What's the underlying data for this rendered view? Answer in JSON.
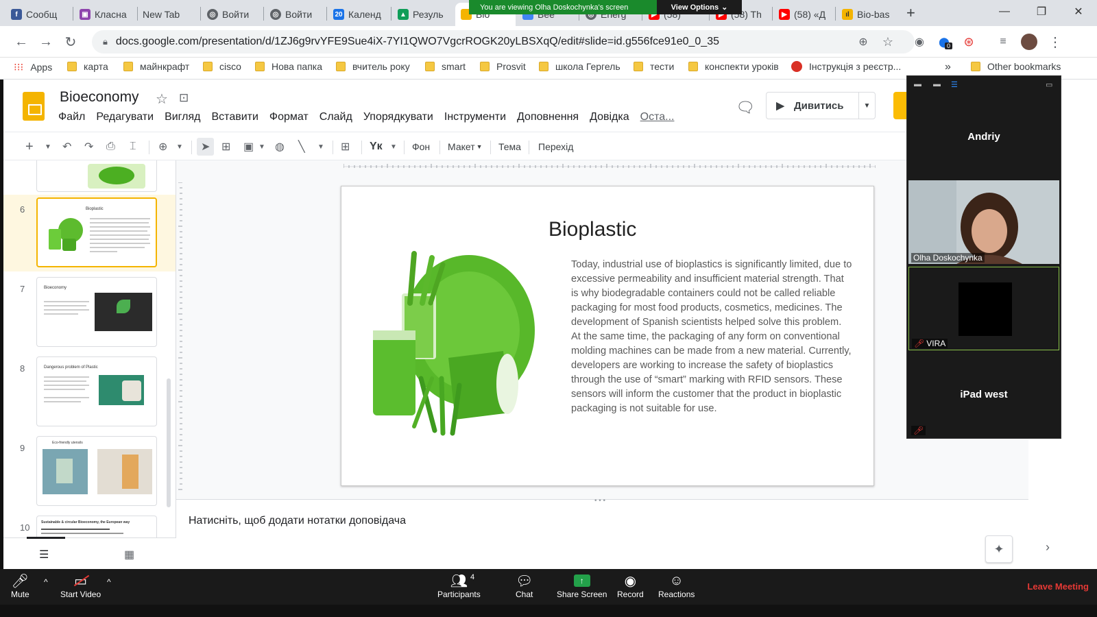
{
  "browser": {
    "tabs": [
      {
        "label": "Сообщ",
        "icon": "facebook-icon"
      },
      {
        "label": "Класна",
        "icon": "classroom-icon"
      },
      {
        "label": "New Tab",
        "icon": ""
      },
      {
        "label": "Войти",
        "icon": "globe-icon"
      },
      {
        "label": "Войти",
        "icon": "globe-icon"
      },
      {
        "label": "Календ",
        "icon": "calendar-icon"
      },
      {
        "label": "Резуль",
        "icon": "drive-icon"
      },
      {
        "label": "Bio",
        "icon": "slides-icon"
      },
      {
        "label": "Bee",
        "icon": "docs-icon"
      },
      {
        "label": "Energ",
        "icon": "globe-icon"
      },
      {
        "label": "(58)",
        "icon": "youtube-icon"
      },
      {
        "label": "(58) Th",
        "icon": "youtube-icon"
      },
      {
        "label": "(58) «Д",
        "icon": "youtube-icon"
      },
      {
        "label": "Bio-bas",
        "icon": "chart-icon"
      }
    ],
    "new_tab": "+",
    "url": "docs.google.com/presentation/d/1ZJ6g9rvYFE9Sue4iX-7YI1QWO7VgcrROGK20yLBSXqQ/edit#slide=id.g556fce91e0_0_35",
    "extension_badge": "0",
    "bookmarks": [
      {
        "label": "Apps",
        "icon": "apps-grid-icon"
      },
      {
        "label": "карта",
        "icon": "folder-icon"
      },
      {
        "label": "майнкрафт",
        "icon": "folder-icon"
      },
      {
        "label": "cisco",
        "icon": "folder-icon"
      },
      {
        "label": "Нова папка",
        "icon": "folder-icon"
      },
      {
        "label": "вчитель року",
        "icon": "folder-icon"
      },
      {
        "label": "smart",
        "icon": "folder-icon"
      },
      {
        "label": "Prosvit",
        "icon": "folder-icon"
      },
      {
        "label": "школа Гергель",
        "icon": "folder-icon"
      },
      {
        "label": "тести",
        "icon": "folder-icon"
      },
      {
        "label": "конспекти уроків",
        "icon": "folder-icon"
      },
      {
        "label": "Інструкція з реєстр...",
        "icon": "pdf-icon"
      }
    ],
    "bookmarks_overflow": "»",
    "other_bookmarks": "Other bookmarks"
  },
  "zoom_banner": {
    "viewing_text": "You are viewing Olha Doskochynka's screen",
    "view_options": "View Options"
  },
  "slides": {
    "doc_title": "Bioeconomy",
    "menu": [
      "Файл",
      "Редагувати",
      "Вигляд",
      "Вставити",
      "Формат",
      "Слайд",
      "Упорядкувати",
      "Інструменти",
      "Доповнення",
      "Довідка"
    ],
    "menu_last_edit": "Оста...",
    "present_label": "Дивитись",
    "toolbar": {
      "background": "Фон",
      "layout": "Макет",
      "theme": "Тема",
      "transition": "Перехід"
    },
    "thumbnails": [
      {
        "num": "6",
        "title": "Bioplastic"
      },
      {
        "num": "7",
        "title": "Bioeconomy"
      },
      {
        "num": "8",
        "title": "Dangerous problem of Plastic"
      },
      {
        "num": "9",
        "title": "Eco-friendly utensils"
      },
      {
        "num": "10",
        "title": "Sustainable & circular Bioeconomy, the European way"
      }
    ],
    "current_slide": {
      "title": "Bioplastic",
      "body": "Today, industrial use of bioplastics is significantly limited, due to excessive permeability and insufficient material strength. That is why biodegradable containers could not be called reliable packaging for most food products, cosmetics, medicines. The development of Spanish scientists helped solve this problem. At the same time, the packaging of any form on conventional molding machines can be made from a new material. Currently, developers are working to increase the safety of bioplastics through the use of “smart” marking with RFID sensors. These sensors will inform the customer that the product in bioplastic packaging is not suitable for use."
    },
    "notes_placeholder": "Натисніть, щоб додати нотатки доповідача"
  },
  "zoom_gallery": {
    "participants": [
      {
        "name": "Andriy",
        "video": false,
        "muted": false
      },
      {
        "name": "Olha Doskochynka",
        "video": true,
        "muted": false
      },
      {
        "name": "VIRA",
        "video": true,
        "muted": true
      },
      {
        "name": "iPad west",
        "video": false,
        "muted": true
      }
    ]
  },
  "zoom_toolbar": {
    "mute": "Mute",
    "start_video": "Start Video",
    "participants": "Participants",
    "participants_count": "4",
    "chat": "Chat",
    "share_screen": "Share Screen",
    "record": "Record",
    "reactions": "Reactions",
    "leave": "Leave Meeting"
  },
  "colors": {
    "zoom_banner_green": "#1a8a2c",
    "slides_yellow": "#f4b400",
    "leave_red": "#e53935",
    "share_green": "#23a14a"
  }
}
